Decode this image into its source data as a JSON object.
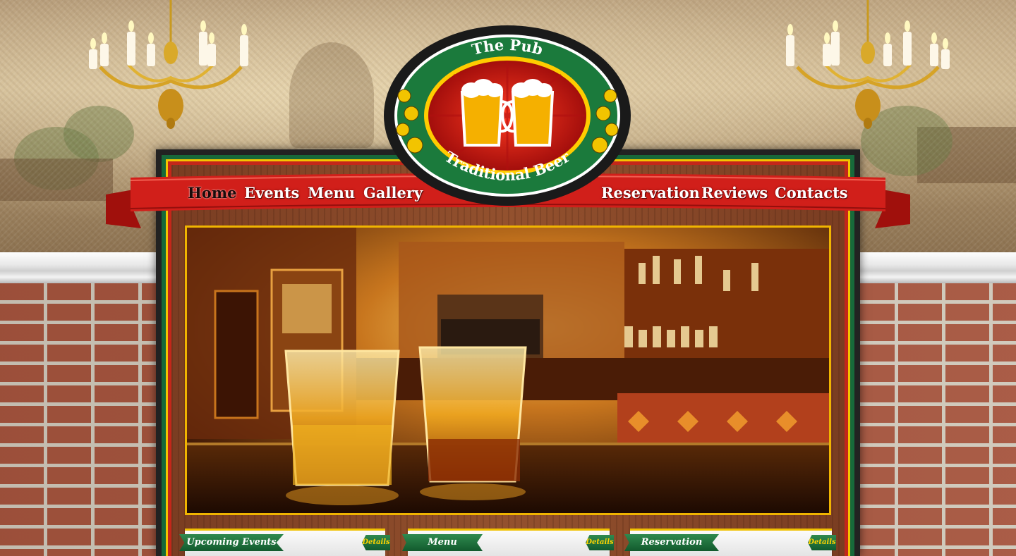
{
  "logo": {
    "top_text": "The Pub",
    "bottom_text": "Traditional Beer"
  },
  "nav": {
    "items": [
      {
        "label": "Home",
        "active": true
      },
      {
        "label": "Events",
        "active": false
      },
      {
        "label": "Menu",
        "active": false
      },
      {
        "label": "Gallery",
        "active": false
      },
      {
        "label": "Reservation",
        "active": false
      },
      {
        "label": "Reviews",
        "active": false
      },
      {
        "label": "Contacts",
        "active": false
      }
    ]
  },
  "panels": [
    {
      "title": "Upcoming Events",
      "details_label": "Details"
    },
    {
      "title": "Menu",
      "details_label": "Details"
    },
    {
      "title": "Reservation",
      "details_label": "Details"
    }
  ],
  "colors": {
    "ribbon_red": "#d11f1a",
    "frame_green": "#17693a",
    "gold": "#f4c400"
  }
}
